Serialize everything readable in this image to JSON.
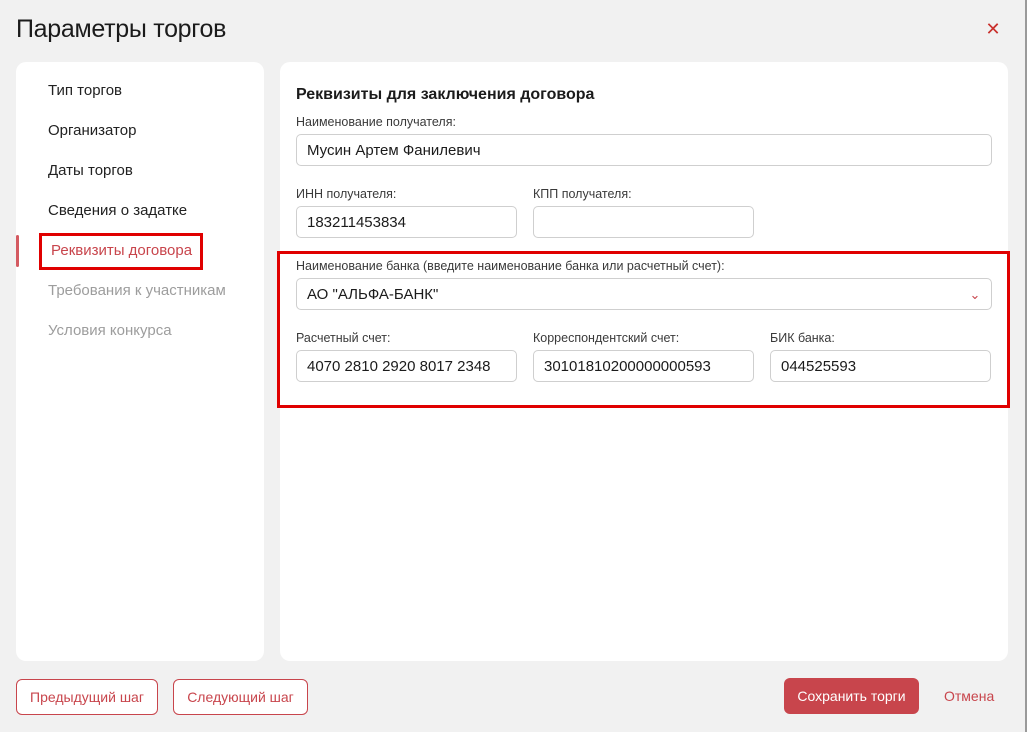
{
  "dialog": {
    "title": "Параметры торгов"
  },
  "sidebar": {
    "items": [
      {
        "label": "Тип торгов"
      },
      {
        "label": "Организатор"
      },
      {
        "label": "Даты торгов"
      },
      {
        "label": "Сведения о задатке"
      },
      {
        "label": "Реквизиты договора"
      },
      {
        "label": "Требования к участникам"
      },
      {
        "label": "Условия конкурса"
      }
    ]
  },
  "form": {
    "section_title": "Реквизиты для заключения договора",
    "recipient_name": {
      "label": "Наименование получателя:",
      "value": "Мусин Артем Фанилевич"
    },
    "recipient_inn": {
      "label": "ИНН получателя:",
      "value": "183211453834"
    },
    "recipient_kpp": {
      "label": "КПП получателя:",
      "value": ""
    },
    "bank_name": {
      "label": "Наименование банка (введите наименование банка или расчетный счет):",
      "value": "АО \"АЛЬФА-БАНК\""
    },
    "account": {
      "label": "Расчетный счет:",
      "value": "4070 2810 2920 8017 2348"
    },
    "corr_account": {
      "label": "Корреспондентский счет:",
      "value": "30101810200000000593"
    },
    "bik": {
      "label": "БИК банка:",
      "value": "044525593"
    }
  },
  "footer": {
    "prev_label": "Предыдущий шаг",
    "next_label": "Следующий шаг",
    "save_label": "Сохранить торги",
    "cancel_label": "Отмена"
  },
  "colors": {
    "accent": "#c8454c",
    "annotation": "#e00000"
  }
}
